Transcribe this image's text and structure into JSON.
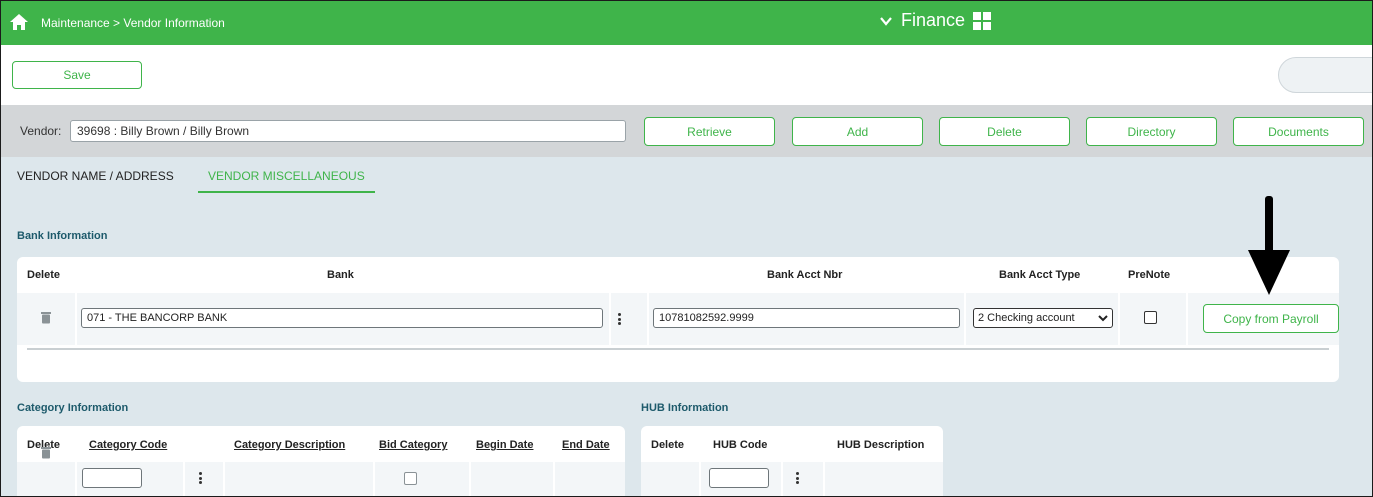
{
  "topbar": {
    "breadcrumb": "Maintenance > Vendor Information",
    "module": "Finance"
  },
  "toolbar": {
    "save_label": "Save"
  },
  "vendor": {
    "label": "Vendor:",
    "value": "39698 : Billy Brown / Billy Brown",
    "buttons": [
      "Retrieve",
      "Add",
      "Delete",
      "Directory",
      "Documents"
    ]
  },
  "tabs": [
    "VENDOR NAME / ADDRESS",
    "VENDOR MISCELLANEOUS"
  ],
  "bank": {
    "title": "Bank Information",
    "headers": {
      "delete": "Delete",
      "bank": "Bank",
      "acct_nbr": "Bank Acct Nbr",
      "acct_type": "Bank Acct Type",
      "prenote": "PreNote"
    },
    "row": {
      "bank": "071 - THE BANCORP BANK",
      "acct_nbr": "10781082592.9999",
      "acct_type": "2 Checking account",
      "prenote": false
    },
    "copy_label": "Copy from Payroll"
  },
  "category": {
    "title": "Category Information",
    "headers": {
      "delete": "Delete",
      "code": "Category Code",
      "desc": "Category Description",
      "bid": "Bid Category",
      "begin": "Begin Date",
      "end": "End Date"
    }
  },
  "hub": {
    "title": "HUB Information",
    "headers": {
      "delete": "Delete",
      "code": "HUB Code",
      "desc": "HUB Description"
    }
  },
  "colors": {
    "accent": "#3fb44a",
    "section_title": "#1d5a6b"
  }
}
